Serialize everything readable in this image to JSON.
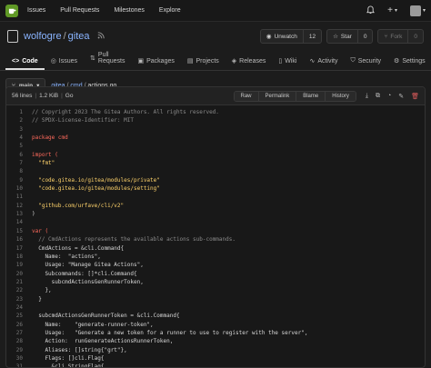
{
  "nav": {
    "items": [
      "Issues",
      "Pull Requests",
      "Milestones",
      "Explore"
    ],
    "plus": "+"
  },
  "repo": {
    "owner": "wolfogre",
    "separator": "/",
    "name": "gitea",
    "unwatch_label": "Unwatch",
    "watch_count": "12",
    "star_label": "Star",
    "star_count": "0",
    "fork_label": "Fork",
    "fork_count": "0"
  },
  "tabs": [
    "Code",
    "Issues",
    "Pull Requests",
    "Packages",
    "Projects",
    "Releases",
    "Wiki",
    "Activity",
    "Security",
    "Settings"
  ],
  "path": {
    "branch": "main",
    "parts": [
      "gitea",
      "cmd",
      "actions.go"
    ]
  },
  "file": {
    "lines": "56 lines",
    "size": "1.2 KiB",
    "lang": "Go",
    "buttons": [
      "Raw",
      "Permalink",
      "Blame",
      "History"
    ]
  },
  "code": [
    {
      "n": "1",
      "t": "// Copyright 2023 The Gitea Authors. All rights reserved.",
      "k": "cm"
    },
    {
      "n": "2",
      "t": "// SPDX-License-Identifier: MIT",
      "k": "cm"
    },
    {
      "n": "3",
      "t": "",
      "k": "tx"
    },
    {
      "n": "4",
      "t": "package cmd",
      "k": "kw"
    },
    {
      "n": "5",
      "t": "",
      "k": "tx"
    },
    {
      "n": "6",
      "t": "import (",
      "k": "kw"
    },
    {
      "n": "7",
      "t": "  \"fmt\"",
      "k": "st"
    },
    {
      "n": "8",
      "t": "",
      "k": "tx"
    },
    {
      "n": "9",
      "t": "  \"code.gitea.io/gitea/modules/private\"",
      "k": "st"
    },
    {
      "n": "10",
      "t": "  \"code.gitea.io/gitea/modules/setting\"",
      "k": "st"
    },
    {
      "n": "11",
      "t": "",
      "k": "tx"
    },
    {
      "n": "12",
      "t": "  \"github.com/urfave/cli/v2\"",
      "k": "st"
    },
    {
      "n": "13",
      "t": ")",
      "k": "tx"
    },
    {
      "n": "14",
      "t": "",
      "k": "tx"
    },
    {
      "n": "15",
      "t": "var (",
      "k": "kw"
    },
    {
      "n": "16",
      "t": "  // CmdActions represents the available actions sub-commands.",
      "k": "cm"
    },
    {
      "n": "17",
      "t": "  CmdActions = &cli.Command{",
      "k": "tx"
    },
    {
      "n": "18",
      "t": "    Name:  \"actions\",",
      "k": "tx"
    },
    {
      "n": "19",
      "t": "    Usage: \"Manage Gitea Actions\",",
      "k": "tx"
    },
    {
      "n": "20",
      "t": "    Subcommands: []*cli.Command{",
      "k": "tx"
    },
    {
      "n": "21",
      "t": "      subcmdActionsGenRunnerToken,",
      "k": "tx"
    },
    {
      "n": "22",
      "t": "    },",
      "k": "tx"
    },
    {
      "n": "23",
      "t": "  }",
      "k": "tx"
    },
    {
      "n": "24",
      "t": "",
      "k": "tx"
    },
    {
      "n": "25",
      "t": "  subcmdActionsGenRunnerToken = &cli.Command{",
      "k": "tx"
    },
    {
      "n": "26",
      "t": "    Name:    \"generate-runner-token\",",
      "k": "tx"
    },
    {
      "n": "27",
      "t": "    Usage:   \"Generate a new token for a runner to use to register with the server\",",
      "k": "tx"
    },
    {
      "n": "28",
      "t": "    Action:  runGenerateActionsRunnerToken,",
      "k": "tx"
    },
    {
      "n": "29",
      "t": "    Aliases: []string{\"grt\"},",
      "k": "tx"
    },
    {
      "n": "30",
      "t": "    Flags: []cli.Flag{",
      "k": "tx"
    },
    {
      "n": "31",
      "t": "      &cli.StringFlag{",
      "k": "tx"
    }
  ]
}
